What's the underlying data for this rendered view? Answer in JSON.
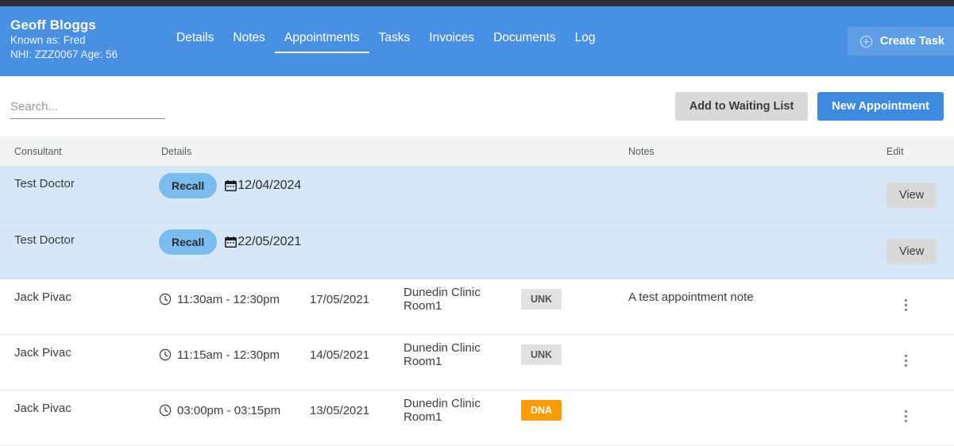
{
  "header": {
    "patient_name": "Geoff Bloggs",
    "known_as": "Known as: Fred",
    "nhi_age": "NHI: ZZZ0067 Age: 56",
    "tabs": [
      {
        "label": "Details",
        "active": false
      },
      {
        "label": "Notes",
        "active": false
      },
      {
        "label": "Appointments",
        "active": true
      },
      {
        "label": "Tasks",
        "active": false
      },
      {
        "label": "Invoices",
        "active": false
      },
      {
        "label": "Documents",
        "active": false
      },
      {
        "label": "Log",
        "active": false
      }
    ],
    "create_task_label": "Create Task",
    "create_task_icon": "plus-circle-icon",
    "bar_color": "#4a90e2",
    "strip_color": "#2b2f38"
  },
  "toolbar": {
    "search_placeholder": "Search...",
    "search_value": "",
    "add_waiting_list_label": "Add to Waiting List",
    "new_appointment_label": "New Appointment",
    "primary_color": "#3f8ae0",
    "secondary_color": "#d9d9d9"
  },
  "table": {
    "columns": [
      "Consultant",
      "Details",
      "Notes",
      "Edit"
    ],
    "rows": [
      {
        "type": "recall",
        "consultant": "Test Doctor",
        "badge": "Recall",
        "date_icon": "calendar-icon",
        "date": "12/04/2024",
        "notes": "",
        "action_label": "View",
        "row_color": "#d6e7fa",
        "badge_color": "#7bbcf0"
      },
      {
        "type": "recall",
        "consultant": "Test Doctor",
        "badge": "Recall",
        "date_icon": "calendar-icon",
        "date": "22/05/2021",
        "notes": "",
        "action_label": "View",
        "row_color": "#d6e7fa",
        "badge_color": "#7bbcf0"
      },
      {
        "type": "appointment",
        "consultant": "Jack Pivac",
        "time_icon": "clock-icon",
        "time": "11:30am - 12:30pm",
        "date": "17/05/2021",
        "room": "Dunedin Clinic Room1",
        "status": "UNK",
        "status_color": "#e2e2e2",
        "notes": "A test appointment note",
        "action_icon": "kebab-menu-icon"
      },
      {
        "type": "appointment",
        "consultant": "Jack Pivac",
        "time_icon": "clock-icon",
        "time": "11:15am - 12:30pm",
        "date": "14/05/2021",
        "room": "Dunedin Clinic Room1",
        "status": "UNK",
        "status_color": "#e2e2e2",
        "notes": "",
        "action_icon": "kebab-menu-icon"
      },
      {
        "type": "appointment",
        "consultant": "Jack Pivac",
        "time_icon": "clock-icon",
        "time": "03:00pm - 03:15pm",
        "date": "13/05/2021",
        "room": "Dunedin Clinic Room1",
        "status": "DNA",
        "status_color": "#fb9c00",
        "notes": "",
        "action_icon": "kebab-menu-icon"
      }
    ]
  }
}
